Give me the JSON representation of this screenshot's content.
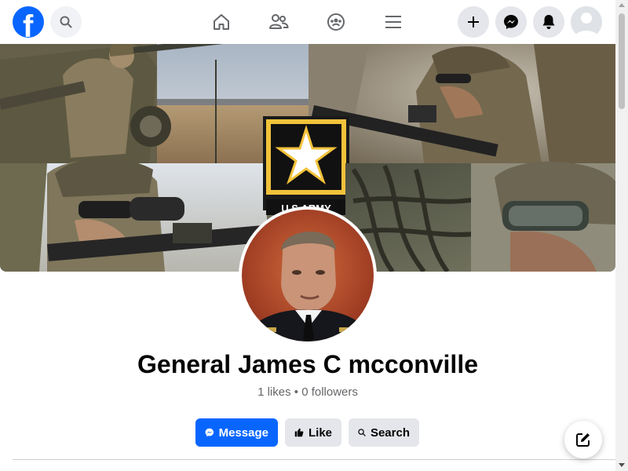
{
  "header": {
    "logo_letter": "f",
    "icons": {
      "search": "search-icon",
      "home": "home-icon",
      "friends": "friends-icon",
      "groups": "groups-icon",
      "menu": "menu-icon",
      "create": "plus-icon",
      "messenger": "messenger-icon",
      "notifications": "bell-icon",
      "account": "avatar"
    }
  },
  "cover": {
    "badge_text": "U.S.ARMY"
  },
  "profile": {
    "name": "General James C mcconville",
    "stats": "1 likes • 0 followers"
  },
  "actions": {
    "message_label": "Message",
    "like_label": "Like",
    "search_label": "Search"
  },
  "colors": {
    "brand": "#0866ff",
    "button_bg": "#e4e6eb",
    "muted_text": "#65676b"
  }
}
